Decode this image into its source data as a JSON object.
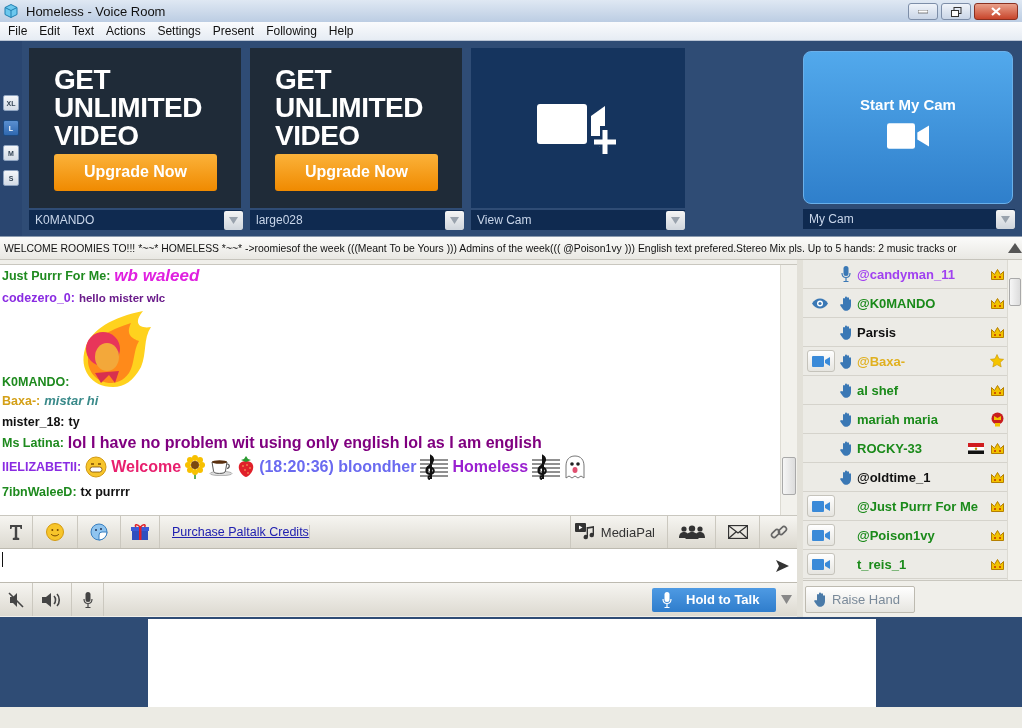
{
  "window": {
    "title": "Homeless - Voice Room"
  },
  "menu": [
    "File",
    "Edit",
    "Text",
    "Actions",
    "Settings",
    "Present",
    "Following",
    "Help"
  ],
  "video_sizes": [
    {
      "label": "XL",
      "selected": false
    },
    {
      "label": "L",
      "selected": true
    },
    {
      "label": "M",
      "selected": false
    },
    {
      "label": "S",
      "selected": false
    }
  ],
  "video_tiles": [
    {
      "kind": "promo",
      "headline": "GET UNLIMITED VIDEO",
      "button": "Upgrade Now",
      "dropdown": "K0MANDO"
    },
    {
      "kind": "promo",
      "headline": "GET UNLIMITED VIDEO",
      "button": "Upgrade Now",
      "dropdown": "large028"
    },
    {
      "kind": "view",
      "dropdown": "View Cam"
    }
  ],
  "my_cam": {
    "button": "Start My Cam",
    "dropdown": "My Cam"
  },
  "banner": "WELCOME ROOMIES TO!!! *~~* HOMELESS *~~* ->roomiesof the week (((Meant To be Yours ))) Admins of the week((( @Poison1vy ))) English text prefered.Stereo Mix pls. Up to 5 hands: 2 music tracks or",
  "chat": {
    "messages": [
      {
        "user": {
          "name": "Just Purrr For Me:",
          "color": "#1e8a1e"
        },
        "kind": "text",
        "body": {
          "kind": "italic-large",
          "text": "wb waleed",
          "color": "#e020e0"
        }
      },
      {
        "user": {
          "name": "codezero_0:",
          "color": "#8a2be2"
        },
        "kind": "text",
        "body": {
          "kind": "small",
          "text": "hello mister wlc",
          "color": "#6a1b8a"
        }
      },
      {
        "user": {
          "name": "K0MANDO:",
          "color": "#1e8a1e"
        },
        "kind": "sticker"
      },
      {
        "user": {
          "name": "Baxa-:",
          "color": "#d4a017"
        },
        "kind": "text",
        "body": {
          "kind": "italic",
          "text": "mistar hi",
          "color": "#3a8a8a"
        }
      },
      {
        "user": {
          "name": "mister_18:",
          "color": "#111111"
        },
        "kind": "text",
        "body": {
          "kind": "bold",
          "text": "ty",
          "color": "#111111"
        }
      },
      {
        "user": {
          "name": "Ms Latina:",
          "color": "#1e8a1e"
        },
        "kind": "text",
        "body": {
          "kind": "large",
          "text": "lol I have no problem wit using only english lol as I am english",
          "color": "#800080"
        }
      },
      {
        "user": {
          "name": "IIELIZABETII:",
          "color": "#8a2be2"
        },
        "kind": "parts",
        "parts": [
          {
            "kind": "grin"
          },
          {
            "kind": "text",
            "text": "Welcome",
            "color": "#e8206e"
          },
          {
            "kind": "sunflower"
          },
          {
            "kind": "cup"
          },
          {
            "kind": "strawberry"
          },
          {
            "kind": "text",
            "text": "(18:20:36) bloondher",
            "color": "#6a6af0"
          },
          {
            "kind": "clef"
          },
          {
            "kind": "text",
            "text": "Homeless",
            "color": "#9a20d0"
          },
          {
            "kind": "clef"
          },
          {
            "kind": "ghost"
          }
        ]
      },
      {
        "user": {
          "name": "7ibnWaleeD:",
          "color": "#1e8a1e"
        },
        "kind": "text",
        "body": {
          "kind": "bold",
          "text": "tx purrrr",
          "color": "#111111"
        }
      }
    ]
  },
  "composer": {
    "link": "Purchase Paltalk Credits",
    "media_button": "MediaPal",
    "talk_button": "Hold to Talk"
  },
  "users": [
    {
      "name": "@candyman_11",
      "color": "#a040f0",
      "cam": false,
      "eye": false,
      "status": {
        "kind": "mic"
      },
      "badge": {
        "kind": "crown"
      },
      "flag": false
    },
    {
      "name": "@K0MANDO",
      "color": "#1a8a1a",
      "cam": false,
      "eye": true,
      "status": {
        "kind": "hand"
      },
      "badge": {
        "kind": "crown"
      },
      "flag": false
    },
    {
      "name": "Parsis",
      "color": "#111111",
      "cam": false,
      "eye": false,
      "status": {
        "kind": "hand"
      },
      "badge": {
        "kind": "crown"
      },
      "flag": false
    },
    {
      "name": "@Baxa-",
      "color": "#e0b020",
      "cam": true,
      "eye": false,
      "status": {
        "kind": "hand"
      },
      "badge": {
        "kind": "star"
      },
      "flag": false
    },
    {
      "name": "al shef",
      "color": "#1a8a1a",
      "cam": false,
      "eye": false,
      "status": {
        "kind": "hand"
      },
      "badge": {
        "kind": "crown"
      },
      "flag": false
    },
    {
      "name": "mariah maria",
      "color": "#1a8a1a",
      "cam": false,
      "eye": false,
      "status": {
        "kind": "hand"
      },
      "badge": {
        "kind": "red-crown"
      },
      "flag": false
    },
    {
      "name": "ROCKY-33",
      "color": "#1a8a1a",
      "cam": false,
      "eye": false,
      "status": {
        "kind": "hand"
      },
      "badge": {
        "kind": "crown"
      },
      "flag": true
    },
    {
      "name": "@oldtime_1",
      "color": "#111111",
      "cam": false,
      "eye": false,
      "status": {
        "kind": "hand"
      },
      "badge": {
        "kind": "crown"
      },
      "flag": false
    },
    {
      "name": "@Just Purrr For Me",
      "color": "#1a8a1a",
      "cam": true,
      "eye": false,
      "badge": {
        "kind": "crown"
      },
      "flag": false
    },
    {
      "name": "@Poison1vy",
      "color": "#1a8a1a",
      "cam": true,
      "eye": false,
      "badge": {
        "kind": "crown"
      },
      "flag": false
    },
    {
      "name": "t_reis_1",
      "color": "#1a8a1a",
      "cam": true,
      "eye": false,
      "badge": {
        "kind": "crown"
      },
      "flag": false
    }
  ],
  "raise_hand": "Raise Hand"
}
